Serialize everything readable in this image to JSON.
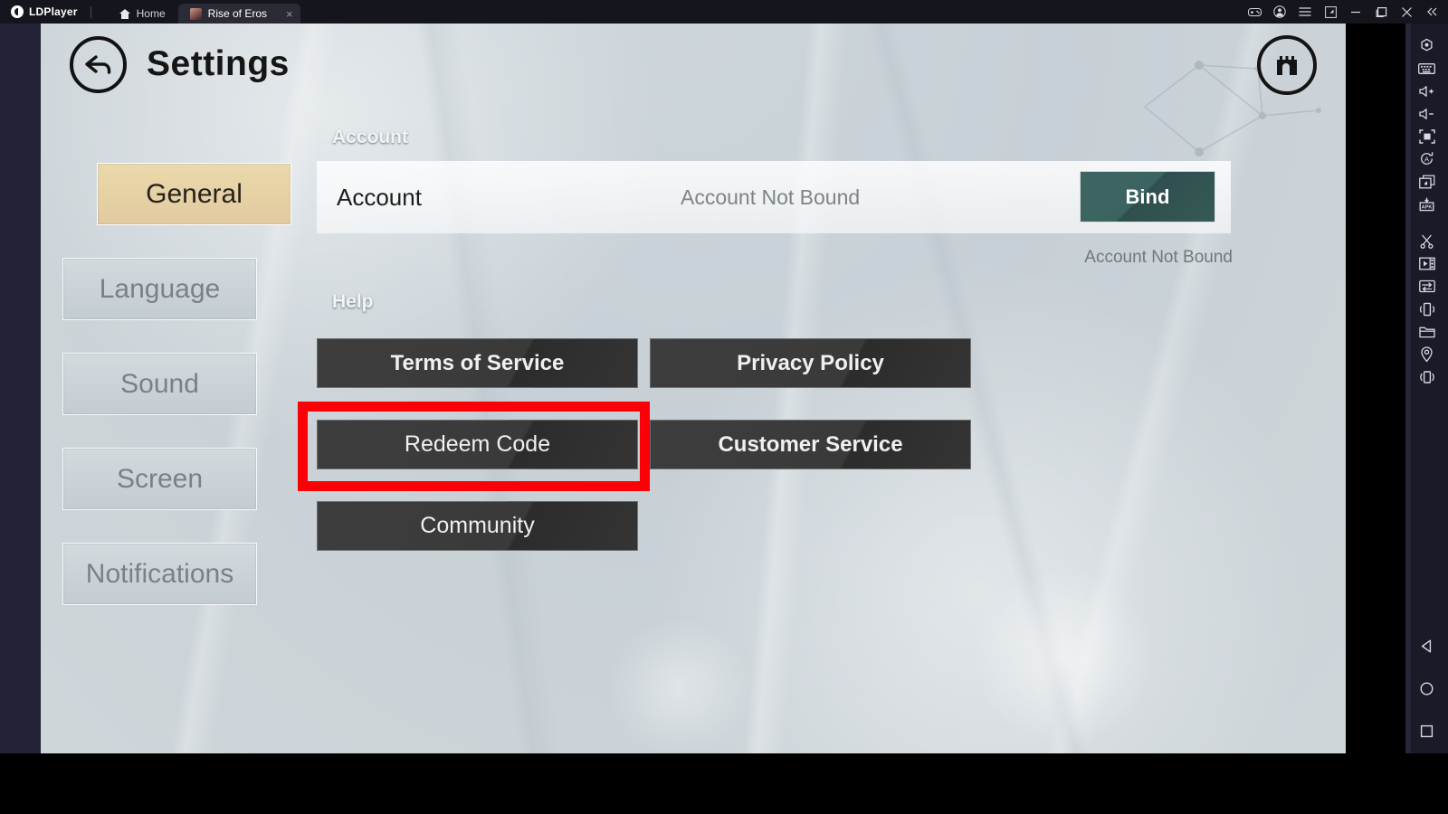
{
  "titlebar": {
    "brand": "LDPlayer",
    "brand_logo_icon": "ldplayer-logo-icon",
    "tabs": [
      {
        "label": "Home",
        "icon": "home-icon",
        "active": false,
        "closable": false
      },
      {
        "label": "Rise of Eros",
        "icon": "game-favicon",
        "active": true,
        "closable": true,
        "close_glyph": "×"
      }
    ],
    "controls": [
      {
        "name": "gamepad-icon",
        "title": "Gamepad"
      },
      {
        "name": "account-icon",
        "title": "Account"
      },
      {
        "name": "menu-icon",
        "title": "Menu"
      },
      {
        "name": "restore-down-icon",
        "title": "Restore"
      },
      {
        "name": "minimize-icon",
        "title": "Minimize"
      },
      {
        "name": "maximize-icon",
        "title": "Maximize"
      },
      {
        "name": "close-icon",
        "title": "Close"
      },
      {
        "name": "collapse-icon",
        "title": "Collapse"
      }
    ]
  },
  "sidebar_right": {
    "icons": [
      "fullscreen-toggle-icon",
      "keyboard-mapping-icon",
      "volume-up-icon",
      "volume-down-icon",
      "maximize-screen-icon",
      "auto-rotate-icon",
      "multi-instance-icon",
      "apk-install-icon",
      "scissors-screenshot-icon",
      "video-record-icon",
      "shared-folder-icon",
      "shake-icon",
      "file-manager-icon",
      "location-icon",
      "virtual-device-icon"
    ],
    "nav": [
      "android-back-icon",
      "android-home-icon",
      "android-recents-icon"
    ]
  },
  "game": {
    "header": {
      "back_icon": "back-arrow-icon",
      "title": "Settings",
      "castle_icon": "castle-icon"
    },
    "tabs": [
      {
        "label": "General",
        "active": true
      },
      {
        "label": "Language",
        "active": false
      },
      {
        "label": "Sound",
        "active": false
      },
      {
        "label": "Screen",
        "active": false
      },
      {
        "label": "Notifications",
        "active": false
      }
    ],
    "account_section": {
      "heading": "Account",
      "row_label": "Account",
      "row_value": "Account Not Bound",
      "bind_button": "Bind",
      "note": "Account Not Bound"
    },
    "help_section": {
      "heading": "Help",
      "buttons": [
        {
          "label": "Terms of Service",
          "highlighted": false
        },
        {
          "label": "Privacy Policy",
          "highlighted": false
        },
        {
          "label": "Redeem Code",
          "highlighted": true
        },
        {
          "label": "Customer Service",
          "highlighted": false
        },
        {
          "label": "Community",
          "highlighted": false
        }
      ]
    },
    "annotation": {
      "name": "redeem-code-highlight",
      "color": "#fb0007"
    }
  },
  "colors": {
    "accent_tab": "#e2caa0",
    "bind_button": "#3b6360",
    "help_button": "#3a3a3a",
    "annotation_red": "#fb0007",
    "titlebar_bg": "#15151d"
  }
}
